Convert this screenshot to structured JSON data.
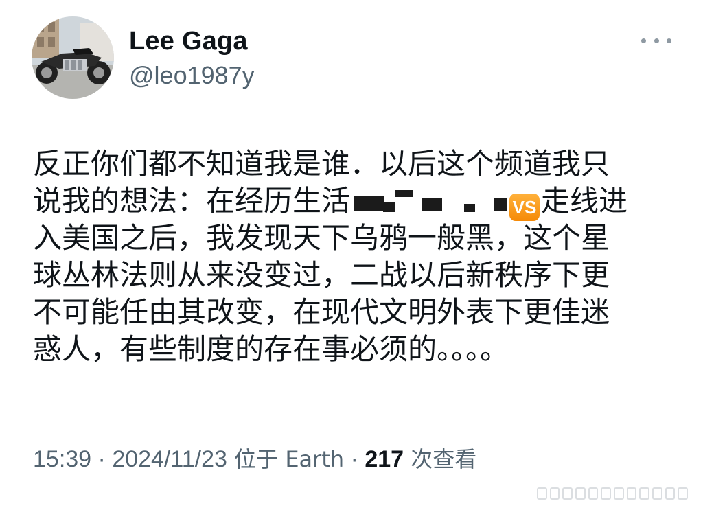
{
  "author": {
    "display_name": "Lee Gaga",
    "handle": "@leo1987y"
  },
  "icons": {
    "avatar": "motorcycle-avatar",
    "more": "more-options-icon",
    "emoji": "vs-emoji"
  },
  "tweet": {
    "lines": [
      "反正你们都不知道我是谁．以后这个频道我只",
      "说我的想法：在经历生活",
      "走线进",
      "入美国之后，我发现天下乌鸦一般黑，这个星",
      "球丛林法则从来没变过，二战以后新秩序下更",
      "不可能任由其改变，在现代文明外表下更佳迷",
      "惑人，有些制度的存在事必须的。。。。"
    ],
    "emoji_label": "VS"
  },
  "meta": {
    "time": "15:39",
    "separator": " · ",
    "date": "2024/11/23",
    "location": " 位于 Earth",
    "views_count": "217",
    "views_label": " 次查看"
  },
  "colors": {
    "text_primary": "#0f1419",
    "text_secondary": "#536471",
    "vs_emoji": "#f58a07"
  }
}
